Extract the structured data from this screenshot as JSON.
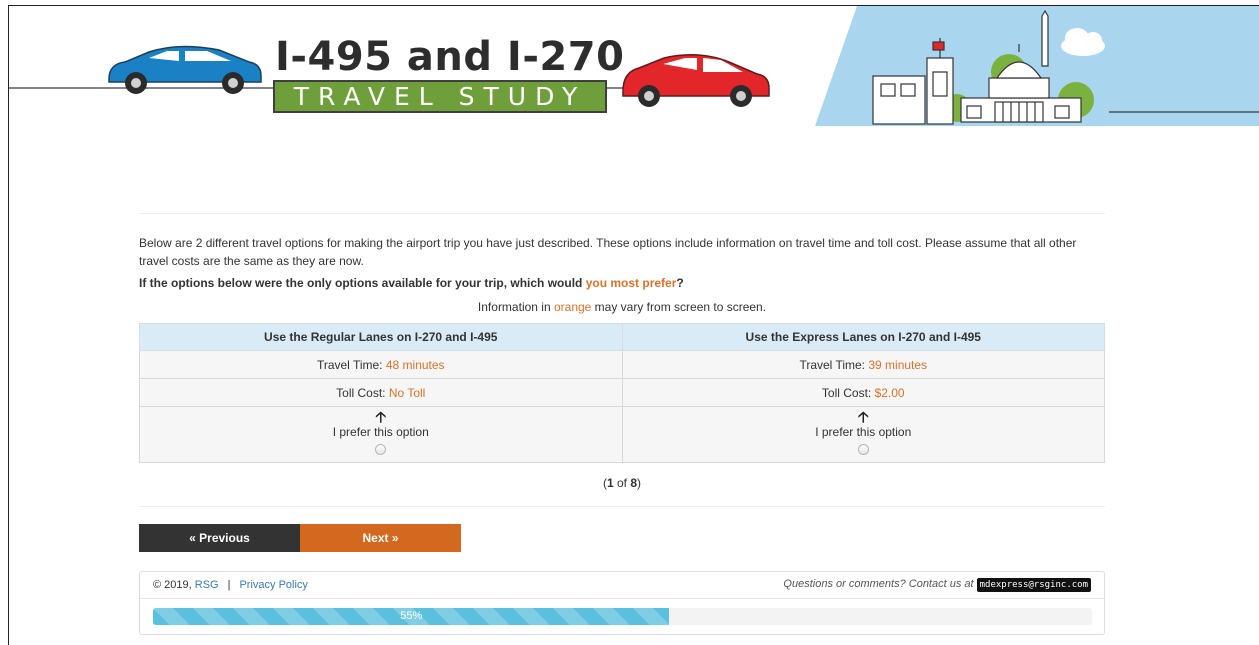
{
  "banner": {
    "title": "I-495 and I-270",
    "subtitle": "TRAVEL STUDY",
    "colors": {
      "sky": "#a9d6ee",
      "subtitle_bg": "#6e9f3b",
      "blue_car": "#1a82c4",
      "red_car": "#e2262a",
      "tree": "#7bb13f"
    }
  },
  "intro": {
    "text": "Below are 2 different travel options for making the airport trip you have just described. These options include information on travel time and toll cost. Please assume that all other travel costs are the same as they are now."
  },
  "question": {
    "prefix": "If the options below were the only options available for your trip, which would ",
    "highlight": "you most prefer",
    "suffix": "?"
  },
  "note": {
    "prefix": "Information in ",
    "highlight": "orange",
    "suffix": " may vary from screen to screen."
  },
  "options": [
    {
      "header": "Use the Regular Lanes on I-270 and I-495",
      "time_label": "Travel Time: ",
      "time_value": "48 minutes",
      "toll_label": "Toll Cost: ",
      "toll_value": "No Toll",
      "prefer_label": "I prefer this option",
      "selected": false
    },
    {
      "header": "Use the Express Lanes on I-270 and I-495",
      "time_label": "Travel Time: ",
      "time_value": "39 minutes",
      "toll_label": "Toll Cost: ",
      "toll_value": "$2.00",
      "prefer_label": "I prefer this option",
      "selected": false
    }
  ],
  "pager": {
    "open": "(",
    "current": "1",
    "of": " of ",
    "total": "8",
    "close": ")"
  },
  "nav": {
    "previous_label": "« Previous",
    "next_label": "Next »"
  },
  "footer": {
    "copyright": "© 2019, ",
    "org_link": "RSG",
    "separator": "|",
    "privacy_link": "Privacy Policy",
    "contact_text": "Questions or comments? Contact us at ",
    "email": "mdexpress@rsginc.com"
  },
  "progress": {
    "percent": 55,
    "label": "55%"
  },
  "accent_colors": {
    "orange": "#d8722a",
    "next_button": "#d2691e",
    "prev_button": "#333333",
    "table_header": "#d9ebf6",
    "progress": "#5bc0de"
  }
}
